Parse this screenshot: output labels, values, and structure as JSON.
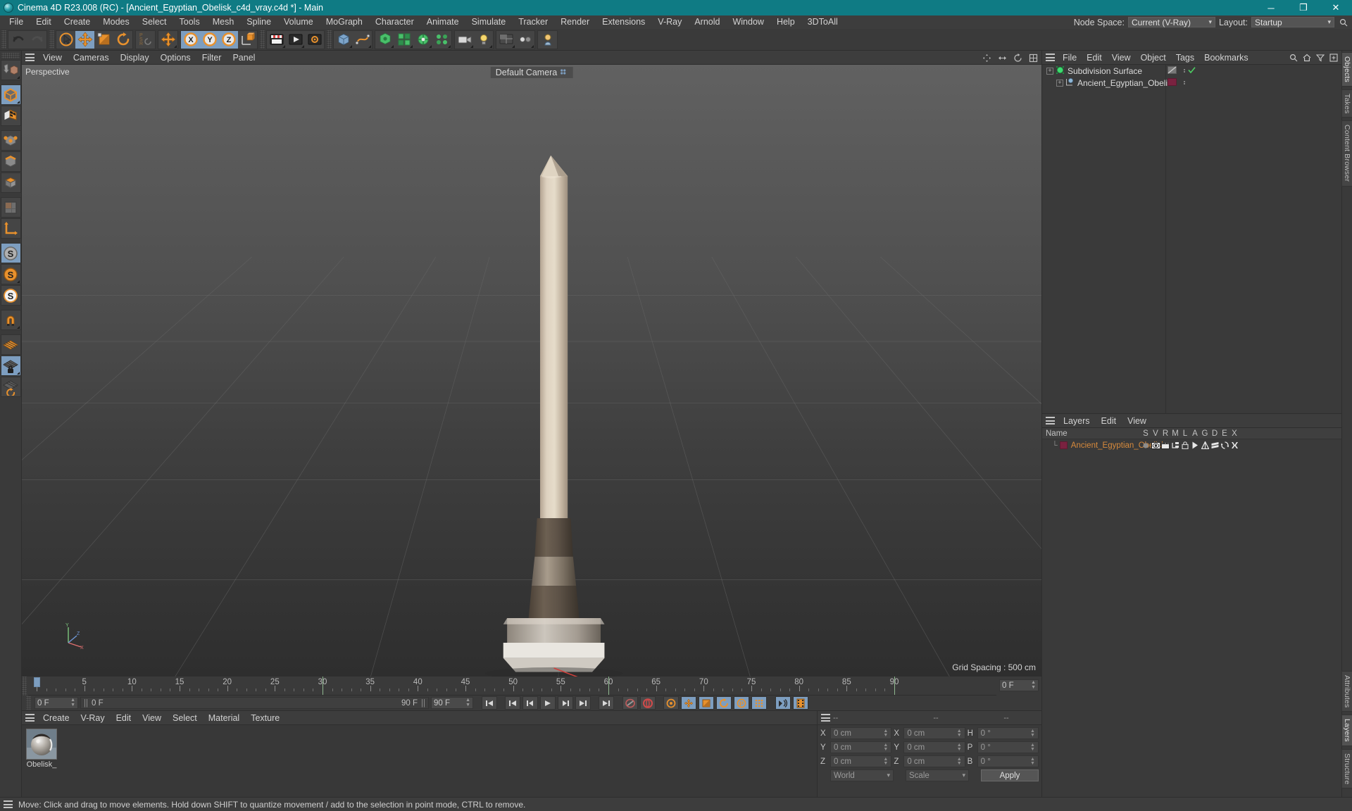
{
  "window": {
    "title": "Cinema 4D R23.008 (RC) - [Ancient_Egyptian_Obelisk_c4d_vray.c4d *] - Main",
    "minimize": "─",
    "maximize": "❐",
    "close": "✕"
  },
  "menubar": {
    "items": [
      "File",
      "Edit",
      "Create",
      "Modes",
      "Select",
      "Tools",
      "Mesh",
      "Spline",
      "Volume",
      "MoGraph",
      "Character",
      "Animate",
      "Simulate",
      "Tracker",
      "Render",
      "Extensions",
      "V-Ray",
      "Arnold",
      "Window",
      "Help",
      "3DToAll"
    ],
    "node_space_label": "Node Space:",
    "node_space_value": "Current (V-Ray)",
    "layout_label": "Layout:",
    "layout_value": "Startup"
  },
  "viewport": {
    "menu": [
      "View",
      "Cameras",
      "Display",
      "Options",
      "Filter",
      "Panel"
    ],
    "projection_label": "Perspective",
    "camera_label": "Default Camera",
    "grid_spacing": "Grid Spacing : 500 cm",
    "axis_x": "X",
    "axis_y": "Y",
    "axis_z": "Z"
  },
  "timeline": {
    "ticks": [
      0,
      5,
      10,
      15,
      20,
      25,
      30,
      35,
      40,
      45,
      50,
      55,
      60,
      65,
      70,
      75,
      80,
      85,
      90
    ],
    "current_frame_field": "0 F",
    "preview_min_field": "0 F",
    "preview_max_field": "90 F",
    "end_frame_field": "90 F",
    "end_frame_right": "0 F",
    "playhead_frame": 0
  },
  "materials": {
    "menu": [
      "Create",
      "V-Ray",
      "Edit",
      "View",
      "Select",
      "Material",
      "Texture"
    ],
    "items": [
      {
        "name": "Obelisk_"
      }
    ]
  },
  "coordinates": {
    "header": [
      "--",
      "--",
      "--"
    ],
    "position": [
      {
        "label": "X",
        "value": "0 cm"
      },
      {
        "label": "Y",
        "value": "0 cm"
      },
      {
        "label": "Z",
        "value": "0 cm"
      }
    ],
    "size": [
      {
        "label": "X",
        "value": "0 cm"
      },
      {
        "label": "Y",
        "value": "0 cm"
      },
      {
        "label": "Z",
        "value": "0 cm"
      }
    ],
    "rotation": [
      {
        "label": "H",
        "value": "0 °"
      },
      {
        "label": "P",
        "value": "0 °"
      },
      {
        "label": "B",
        "value": "0 °"
      }
    ],
    "system_value": "World",
    "mode_value": "Scale",
    "apply_label": "Apply"
  },
  "objects": {
    "menu": [
      "File",
      "Edit",
      "View",
      "Object",
      "Tags",
      "Bookmarks"
    ],
    "rows": [
      {
        "name": "Subdivision Surface",
        "indent": 0,
        "color": "#3ddc6e",
        "tag_color": "#7a7a7a",
        "has_check": true
      },
      {
        "name": "Ancient_Egyptian_Obelisk",
        "indent": 1,
        "color": "#8fb8d8",
        "tag_color": "#7a2240",
        "has_check": false
      }
    ]
  },
  "layers": {
    "menu": [
      "Layers",
      "Edit",
      "View"
    ],
    "columns": [
      "Name",
      "S",
      "V",
      "R",
      "M",
      "L",
      "A",
      "G",
      "D",
      "E",
      "X"
    ],
    "rows": [
      {
        "name": "Ancient_Egyptian_Obelisk",
        "color": "#7a2240"
      }
    ]
  },
  "right_tabs": [
    "Objects",
    "Takes",
    "Content Browser",
    "Attributes",
    "Layers",
    "Structure"
  ],
  "statusbar": {
    "text": "Move: Click and drag to move elements. Hold down SHIFT to quantize movement / add to the selection in point mode, CTRL to remove."
  },
  "colors": {
    "title_bar": "#0f7b84",
    "accent_orange": "#e8912d",
    "selection_blue": "#7d9ec0",
    "panel_bg": "#3a3a3a",
    "layer_swatch": "#7a2240"
  }
}
